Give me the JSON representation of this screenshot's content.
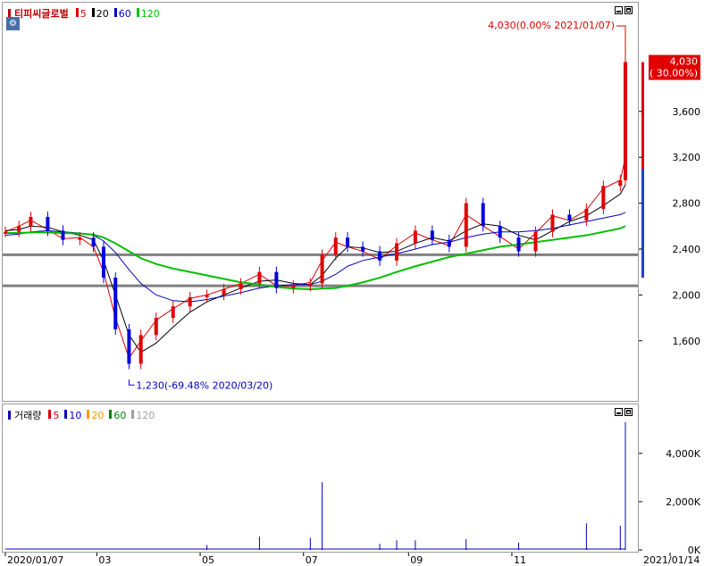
{
  "price_panel": {
    "stock_name": "티피씨글로벌",
    "ma_legend": [
      {
        "label": "5",
        "color": "#e00000"
      },
      {
        "label": "20",
        "color": "#000000"
      },
      {
        "label": "60",
        "color": "#0000c0"
      },
      {
        "label": "120",
        "color": "#00c000"
      }
    ],
    "corner_icon": "settings-icon",
    "high_annotation": "4,030(0.00% 2021/01/07)",
    "low_annotation": "1,230(-69.48% 2020/03/20)",
    "last_price": "4,030",
    "last_change": "( 30.00%)"
  },
  "volume_panel": {
    "title": "거래량",
    "ma_legend": [
      {
        "label": "5",
        "color": "#e00000"
      },
      {
        "label": "10",
        "color": "#0000c0"
      },
      {
        "label": "20",
        "color": "#ff9900"
      },
      {
        "label": "60",
        "color": "#008000"
      },
      {
        "label": "120",
        "color": "#a0a0a0"
      }
    ]
  },
  "x_axis_labels": [
    "2020/01/07",
    "03",
    "05",
    "07",
    "09",
    "11",
    "2021/01/14"
  ],
  "chart_data": [
    {
      "type": "candlestick",
      "ylim": [
        1100,
        4400
      ],
      "yticks": [
        1600,
        2000,
        2400,
        2800,
        3200,
        3600
      ],
      "ytick_labels": [
        "1,600",
        "2,000",
        "2,400",
        "2,800",
        "3,200",
        "3,600"
      ],
      "grid": false,
      "horizontal_lines": [
        2350,
        2080
      ],
      "high_point": {
        "date": "2021/01/07",
        "value": 4030
      },
      "low_point": {
        "date": "2020/03/20",
        "value": 1230
      },
      "close_series": [
        [
          "2020-01-07",
          2550
        ],
        [
          "2020-01-15",
          2600
        ],
        [
          "2020-01-22",
          2680
        ],
        [
          "2020-02-01",
          2560
        ],
        [
          "2020-02-10",
          2480
        ],
        [
          "2020-02-20",
          2500
        ],
        [
          "2020-02-28",
          2420
        ],
        [
          "2020-03-05",
          2150
        ],
        [
          "2020-03-12",
          1700
        ],
        [
          "2020-03-20",
          1400
        ],
        [
          "2020-03-27",
          1650
        ],
        [
          "2020-04-05",
          1800
        ],
        [
          "2020-04-15",
          1900
        ],
        [
          "2020-04-25",
          1980
        ],
        [
          "2020-05-05",
          2000
        ],
        [
          "2020-05-15",
          2050
        ],
        [
          "2020-05-25",
          2100
        ],
        [
          "2020-06-05",
          2200
        ],
        [
          "2020-06-15",
          2060
        ],
        [
          "2020-06-25",
          2080
        ],
        [
          "2020-07-05",
          2100
        ],
        [
          "2020-07-12",
          2350
        ],
        [
          "2020-07-20",
          2500
        ],
        [
          "2020-07-27",
          2420
        ],
        [
          "2020-08-05",
          2380
        ],
        [
          "2020-08-15",
          2300
        ],
        [
          "2020-08-25",
          2450
        ],
        [
          "2020-09-05",
          2560
        ],
        [
          "2020-09-15",
          2480
        ],
        [
          "2020-09-25",
          2420
        ],
        [
          "2020-10-05",
          2800
        ],
        [
          "2020-10-15",
          2600
        ],
        [
          "2020-10-25",
          2500
        ],
        [
          "2020-11-05",
          2380
        ],
        [
          "2020-11-15",
          2550
        ],
        [
          "2020-11-25",
          2700
        ],
        [
          "2020-12-05",
          2650
        ],
        [
          "2020-12-15",
          2750
        ],
        [
          "2020-12-25",
          2950
        ],
        [
          "2021-01-04",
          3000
        ],
        [
          "2021-01-07",
          4030
        ]
      ],
      "ma_series": [
        {
          "name": "5",
          "color": "#e00000",
          "values": [
            2550,
            2600,
            2650,
            2570,
            2490,
            2500,
            2420,
            2200,
            1800,
            1450,
            1600,
            1780,
            1880,
            1970,
            2000,
            2050,
            2100,
            2180,
            2080,
            2080,
            2110,
            2300,
            2460,
            2420,
            2380,
            2310,
            2430,
            2540,
            2480,
            2430,
            2700,
            2600,
            2510,
            2400,
            2540,
            2690,
            2650,
            2740,
            2930,
            3000,
            3200
          ]
        },
        {
          "name": "20",
          "color": "#000000",
          "values": [
            2560,
            2570,
            2600,
            2590,
            2550,
            2520,
            2480,
            2300,
            2000,
            1650,
            1500,
            1580,
            1720,
            1850,
            1940,
            2000,
            2060,
            2120,
            2130,
            2100,
            2090,
            2170,
            2320,
            2420,
            2410,
            2370,
            2380,
            2450,
            2500,
            2470,
            2560,
            2620,
            2600,
            2520,
            2480,
            2560,
            2640,
            2690,
            2780,
            2880,
            2960
          ]
        },
        {
          "name": "60",
          "color": "#0000c0",
          "values": [
            2520,
            2530,
            2550,
            2560,
            2550,
            2540,
            2520,
            2470,
            2370,
            2220,
            2100,
            2000,
            1950,
            1940,
            1960,
            1990,
            2020,
            2060,
            2080,
            2090,
            2090,
            2120,
            2180,
            2250,
            2300,
            2330,
            2360,
            2400,
            2440,
            2460,
            2500,
            2530,
            2550,
            2550,
            2560,
            2580,
            2610,
            2640,
            2670,
            2700,
            2720
          ]
        },
        {
          "name": "120",
          "color": "#00c000",
          "values": [
            2540,
            2540,
            2545,
            2545,
            2540,
            2535,
            2525,
            2500,
            2450,
            2380,
            2320,
            2270,
            2230,
            2200,
            2170,
            2140,
            2110,
            2090,
            2070,
            2055,
            2050,
            2055,
            2060,
            2080,
            2110,
            2150,
            2200,
            2250,
            2290,
            2330,
            2360,
            2390,
            2420,
            2440,
            2460,
            2480,
            2500,
            2520,
            2550,
            2580,
            2600
          ]
        }
      ]
    },
    {
      "type": "bar",
      "ylim": [
        0,
        5400
      ],
      "yticks": [
        0,
        2000,
        4000
      ],
      "ytick_labels": [
        "0K",
        "2,000K",
        "4,000K"
      ],
      "grid": false,
      "spikes": [
        {
          "date": "2020-05-05",
          "value": 200
        },
        {
          "date": "2020-06-05",
          "value": 550
        },
        {
          "date": "2020-07-05",
          "value": 500
        },
        {
          "date": "2020-07-12",
          "value": 2800
        },
        {
          "date": "2020-08-15",
          "value": 250
        },
        {
          "date": "2020-08-25",
          "value": 400
        },
        {
          "date": "2020-09-05",
          "value": 400
        },
        {
          "date": "2020-10-05",
          "value": 450
        },
        {
          "date": "2020-11-05",
          "value": 300
        },
        {
          "date": "2020-12-15",
          "value": 1100
        },
        {
          "date": "2021-01-04",
          "value": 1000
        },
        {
          "date": "2021-01-07",
          "value": 5300
        }
      ]
    }
  ]
}
